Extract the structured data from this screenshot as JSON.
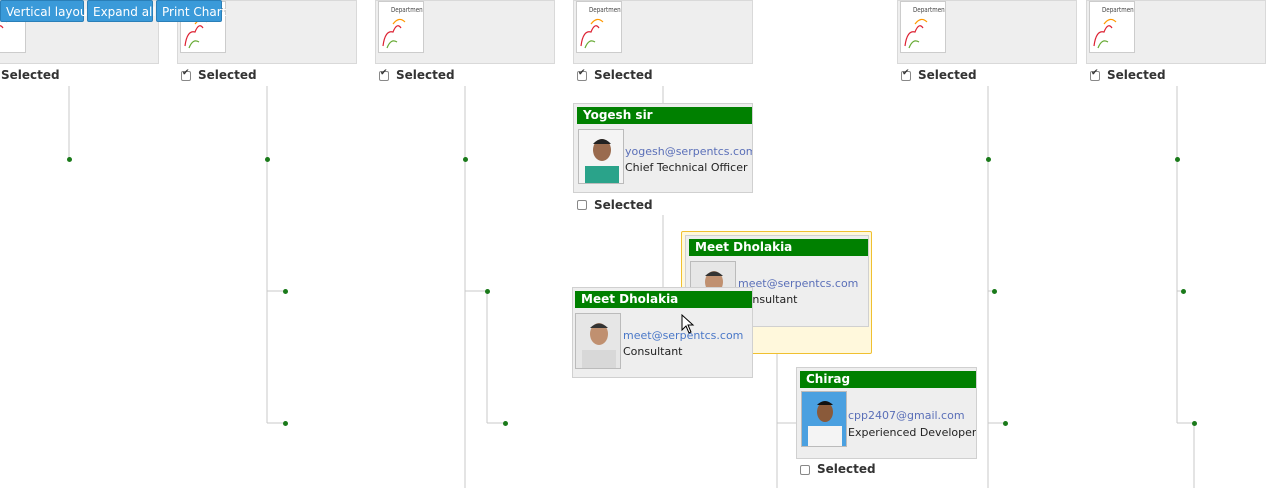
{
  "toolbar": {
    "vertical_layout": "Vertical layout",
    "expand_all": "Expand all",
    "print_chart": "Print Chart"
  },
  "logo_text": "Department",
  "selected_label": "Selected",
  "top_checkboxes": [
    false,
    true,
    true,
    true,
    true,
    true
  ],
  "people": {
    "yogesh": {
      "name": "Yogesh sir",
      "email": "yogesh@serpentcs.com",
      "role": "Chief Technical Officer",
      "selected": false
    },
    "meet_ghost": {
      "name": "Meet Dholakia",
      "email": "meet@serpentcs.com",
      "role": "Consultant"
    },
    "meet_drag": {
      "name": "Meet Dholakia",
      "email": "meet@serpentcs.com",
      "role": "Consultant"
    },
    "chirag": {
      "name": "Chirag",
      "email": "cpp2407@gmail.com",
      "role": "Experienced Developer",
      "selected": false
    }
  },
  "colors": {
    "header_green": "#008000",
    "button_blue": "#3a9ad9",
    "email_blue": "#5a6fb8",
    "line_gray": "#c8c8c8"
  }
}
